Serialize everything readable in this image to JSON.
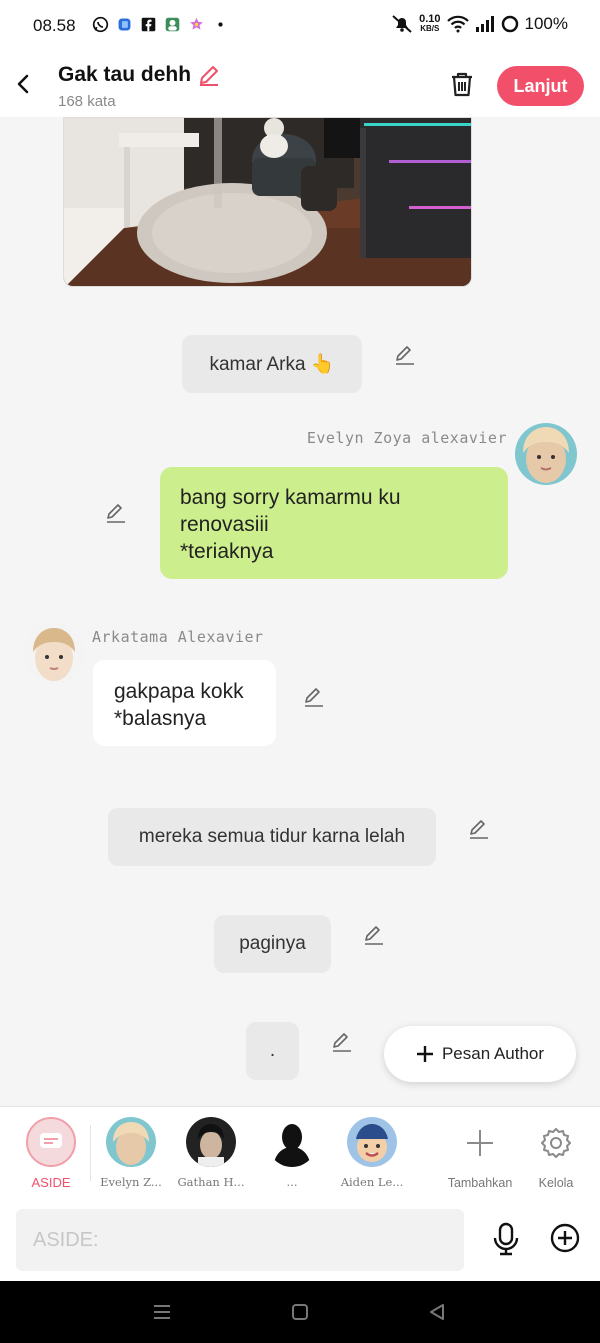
{
  "status_bar": {
    "time": "08.58",
    "net_speed": "0.10",
    "net_unit": "KB/S",
    "battery": "100%"
  },
  "header": {
    "title": "Gak tau dehh",
    "word_count": "168 kata",
    "next_label": "Lanjut"
  },
  "messages": {
    "narration_1": "kamar Arka 👆",
    "sender_1_name": "Evelyn Zoya alexavier",
    "sender_1_text": "bang sorry kamarmu ku\nrenovasiii\n*teriaknya",
    "sender_2_name": "Arkatama Alexavier",
    "sender_2_text": "gakpapa kokk\n*balasnya",
    "narration_2": "mereka semua tidur karna lelah",
    "narration_3": "paginya",
    "narration_4": "."
  },
  "author_button": "Pesan Author",
  "characters": {
    "aside": "ASIDE",
    "c1": "Evelyn Z...",
    "c2": "Gathan H...",
    "c3": "...",
    "c4": "Aiden Le...",
    "add": "Tambahkan",
    "manage": "Kelola"
  },
  "input": {
    "placeholder": "ASIDE:"
  },
  "colors": {
    "accent": "#f2506a",
    "green_bubble": "#cdee8c"
  }
}
